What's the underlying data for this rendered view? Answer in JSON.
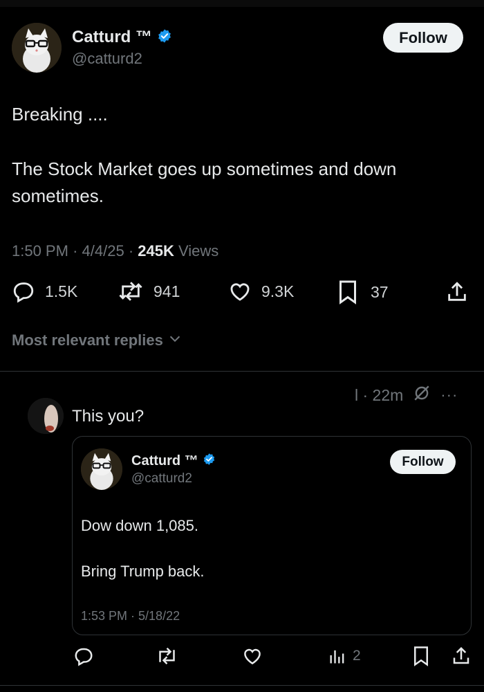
{
  "post": {
    "display_name": "Catturd ™",
    "handle": "@catturd2",
    "follow_label": "Follow",
    "text_line1": "Breaking ....",
    "text_line2": "The Stock Market goes up sometimes and down",
    "text_line3": "sometimes.",
    "time": "1:50 PM",
    "date": "4/4/25",
    "views_count": "245K",
    "views_label": "Views",
    "sep": "·",
    "stats": {
      "replies": "1.5K",
      "reposts": "941",
      "likes": "9.3K",
      "bookmarks": "37"
    }
  },
  "replies_header": "Most relevant replies",
  "reply": {
    "meta": "l · 22m",
    "more": "···",
    "text": "This you?",
    "quote": {
      "display_name": "Catturd ™",
      "handle": "@catturd2",
      "follow_label": "Follow",
      "line1": "Dow down 1,085.",
      "line2": "Bring Trump back.",
      "time": "1:53 PM · 5/18/22"
    },
    "views": "2"
  },
  "colors": {
    "background": "#000000",
    "text": "#e7e9ea",
    "muted": "#71767b",
    "verified": "#1d9bf0"
  }
}
